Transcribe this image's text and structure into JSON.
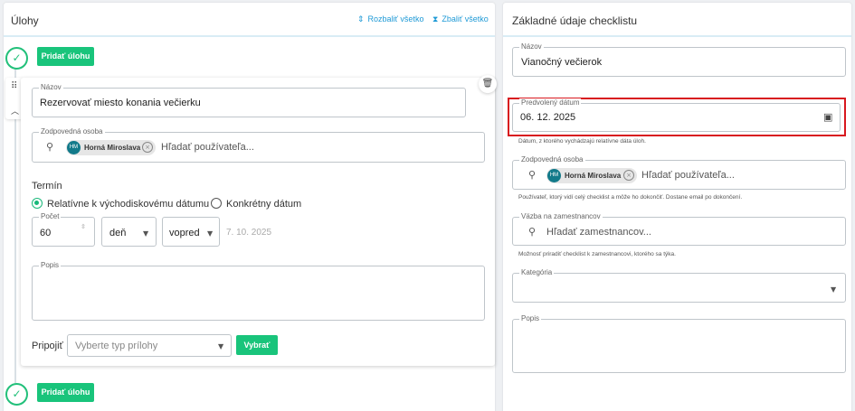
{
  "left_panel": {
    "title": "Úlohy",
    "expand_all": "Rozbaliť všetko",
    "collapse_all": "Zbaliť všetko",
    "add_task_top": "Pridať úlohu",
    "add_task_bottom": "Pridať úlohu",
    "task": {
      "name_label": "Názov",
      "name_value": "Rezervovať  miesto konania večierku",
      "person_label": "Zodpovedná osoba",
      "person_chip": {
        "initials": "HM",
        "name": "Horná Miroslava"
      },
      "person_placeholder": "Hľadať používateľa...",
      "term_label": "Termín",
      "radio_relative": "Relatívne k východiskovému dátumu",
      "radio_specific": "Konkrétny dátum",
      "count_label": "Počet",
      "count_value": "60",
      "unit_value": "deň",
      "direction_value": "vopred",
      "computed_date": "7. 10. 2025",
      "desc_label": "Popis",
      "attach_label": "Pripojiť",
      "attach_placeholder": "Vyberte typ prílohy",
      "choose_button": "Vybrať"
    }
  },
  "right_panel": {
    "title": "Základné údaje checklistu",
    "name_label": "Názov",
    "name_value": "Vianočný večierok",
    "date_label": "Predvolený dátum",
    "date_value": "06. 12. 2025",
    "date_hint": "Dátum, z ktorého vychádzajú relatívne dáta úloh.",
    "person_label": "Zodpovedná osoba",
    "person_chip": {
      "initials": "HM",
      "name": "Horná Miroslava"
    },
    "person_placeholder": "Hľadať používateľa...",
    "person_hint": "Používateľ, ktorý vidí celý checklist a môže ho dokončiť. Dostane email po dokončení.",
    "employee_label": "Väzba na zamestnancov",
    "employee_placeholder": "Hľadať zamestnancov...",
    "employee_hint": "Možnosť priradiť checklist k zamestnancovi, ktorého sa týka.",
    "category_label": "Kategória",
    "category_value": "",
    "desc_label": "Popis"
  },
  "icons": {
    "expand": "expand-icon",
    "collapse": "collapse-icon",
    "add_task": "add-task-icon",
    "drag": "drag-handle-icon",
    "collapse_card": "chevron-up-icon",
    "delete": "trash-icon",
    "search": "search-icon",
    "calendar": "calendar-icon",
    "dropdown": "caret-down-icon"
  },
  "colors": {
    "accent_green": "#19c47b",
    "link_blue": "#1f9ad6",
    "highlight_red": "#d8181f",
    "avatar_teal": "#127a8a"
  }
}
